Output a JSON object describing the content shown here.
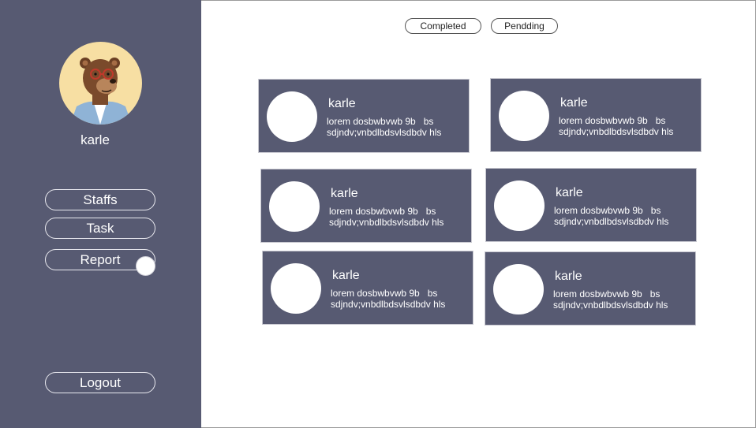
{
  "sidebar": {
    "username": "karle",
    "nav": [
      {
        "label": "Staffs"
      },
      {
        "label": "Task"
      },
      {
        "label": "Report"
      }
    ],
    "logout_label": "Logout"
  },
  "filters": {
    "completed_label": "Completed",
    "pending_label": "Pendding"
  },
  "cards": [
    {
      "name": "karle",
      "line1": "lorem dosbwbvwb 9b   bs",
      "line2": "sdjndv;vnbdlbdsvlsdbdv hls"
    },
    {
      "name": "karle",
      "line1": "lorem dosbwbvwb 9b   bs",
      "line2": "sdjndv;vnbdlbdsvlsdbdv hls"
    },
    {
      "name": "karle",
      "line1": "lorem dosbwbvwb 9b   bs",
      "line2": "sdjndv;vnbdlbdsvlsdbdv hls"
    },
    {
      "name": "karle",
      "line1": "lorem dosbwbvwb 9b   bs",
      "line2": "sdjndv;vnbdlbdsvlsdbdv hls"
    },
    {
      "name": "karle",
      "line1": "lorem dosbwbvwb 9b   bs",
      "line2": "sdjndv;vnbdlbdsvlsdbdv hls"
    },
    {
      "name": "karle",
      "line1": "lorem dosbwbvwb 9b   bs",
      "line2": "sdjndv;vnbdlbdsvlsdbdv hls"
    }
  ],
  "colors": {
    "sidebar_bg": "#575a72",
    "card_bg": "#575a72",
    "avatar_bg": "#f7dfa3"
  }
}
